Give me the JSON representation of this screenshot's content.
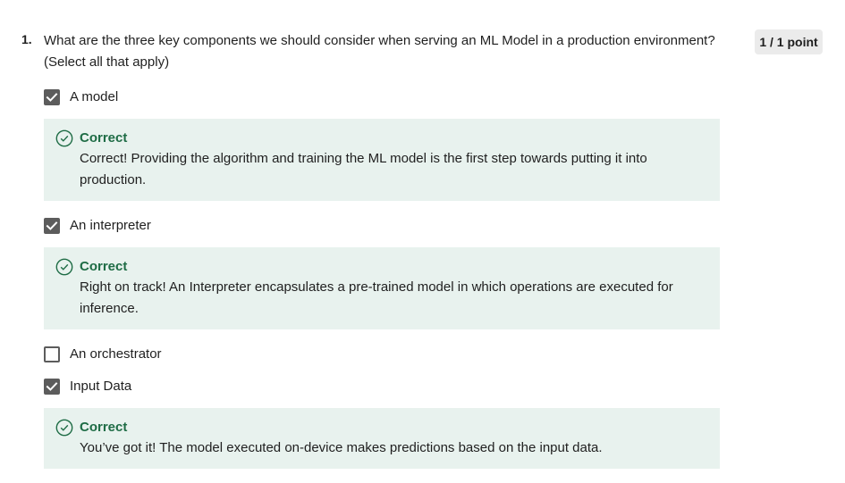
{
  "question": {
    "number": "1.",
    "text": "What are the three key components we should consider when serving an ML Model in a production environment? (Select all that apply)",
    "points": "1 / 1 point"
  },
  "options": [
    {
      "label": "A model",
      "checked": true,
      "feedback": {
        "title": "Correct",
        "text": "Correct! Providing the algorithm and training the ML model is the first step towards putting it into production."
      }
    },
    {
      "label": "An interpreter",
      "checked": true,
      "feedback": {
        "title": "Correct",
        "text": "Right on track! An Interpreter encapsulates a pre-trained model in which operations are executed for inference."
      }
    },
    {
      "label": "An orchestrator",
      "checked": false
    },
    {
      "label": "Input Data",
      "checked": true,
      "feedback": {
        "title": "Correct",
        "text": "You’ve got it!  The model executed on-device makes predictions based on the input data."
      }
    }
  ],
  "colors": {
    "feedback_background": "#e8f2ee",
    "correct_green": "#1e6c45",
    "checkbox_gray": "#5c5c5c",
    "badge_background": "#ebebeb"
  },
  "icons": {
    "checked_checkbox": "checkmark-icon",
    "feedback": "check-circle-icon"
  }
}
